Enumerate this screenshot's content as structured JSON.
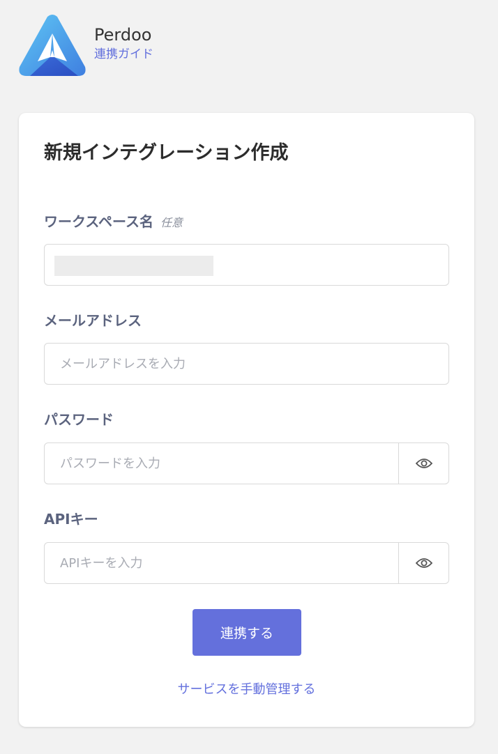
{
  "header": {
    "brand_name": "Perdoo",
    "guide_link": "連携ガイド"
  },
  "form": {
    "title": "新規インテグレーション作成",
    "workspace": {
      "label": "ワークスペース名",
      "optional": "任意",
      "value": ""
    },
    "email": {
      "label": "メールアドレス",
      "placeholder": "メールアドレスを入力"
    },
    "password": {
      "label": "パスワード",
      "placeholder": "パスワードを入力",
      "toggle_icon": "eye-icon"
    },
    "api_key": {
      "label": "APIキー",
      "placeholder": "APIキーを入力",
      "toggle_icon": "eye-icon"
    },
    "submit_label": "連携する",
    "manual_link": "サービスを手動管理する"
  },
  "colors": {
    "accent": "#6470dc",
    "link": "#6370dd",
    "label": "#5b637e",
    "background": "#f2f2f2"
  }
}
